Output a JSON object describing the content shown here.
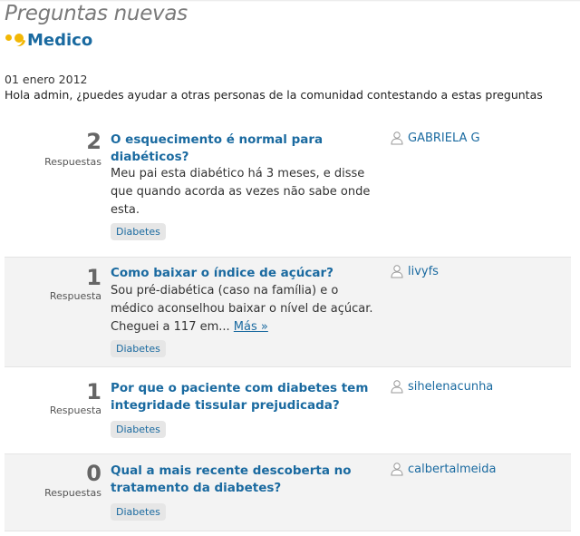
{
  "header": {
    "title": "Preguntas nuevas",
    "brand": "Medico"
  },
  "date": "01 enero 2012",
  "intro": "Hola admin, ¿puedes ayudar a otras personas de la comunidad contestando a estas preguntas",
  "questions": [
    {
      "count": "2",
      "count_label": "Respuestas",
      "title": "O esquecimento é normal para diabéticos?",
      "excerpt": "Meu pai esta diabético há 3 meses, e disse que quando acorda as vezes não sabe onde esta.",
      "more": "",
      "tag": "Diabetes",
      "user": "GABRIELA G"
    },
    {
      "count": "1",
      "count_label": "Respuesta",
      "title": "Como baixar o índice de açúcar?",
      "excerpt": "Sou pré-diabética (caso na família) e o médico aconselhou baixar o nível de açúcar. Cheguei a 117 em...",
      "more": "Más »",
      "tag": "Diabetes",
      "user": "livyfs"
    },
    {
      "count": "1",
      "count_label": "Respuesta",
      "title": "Por que o paciente com diabetes tem integridade tissular prejudicada?",
      "excerpt": "",
      "more": "",
      "tag": "Diabetes",
      "user": "sihelenacunha"
    },
    {
      "count": "0",
      "count_label": "Respuestas",
      "title": "Qual a mais recente descoberta no tratamento da diabetes?",
      "excerpt": "",
      "more": "",
      "tag": "Diabetes",
      "user": "calbertalmeida"
    }
  ]
}
